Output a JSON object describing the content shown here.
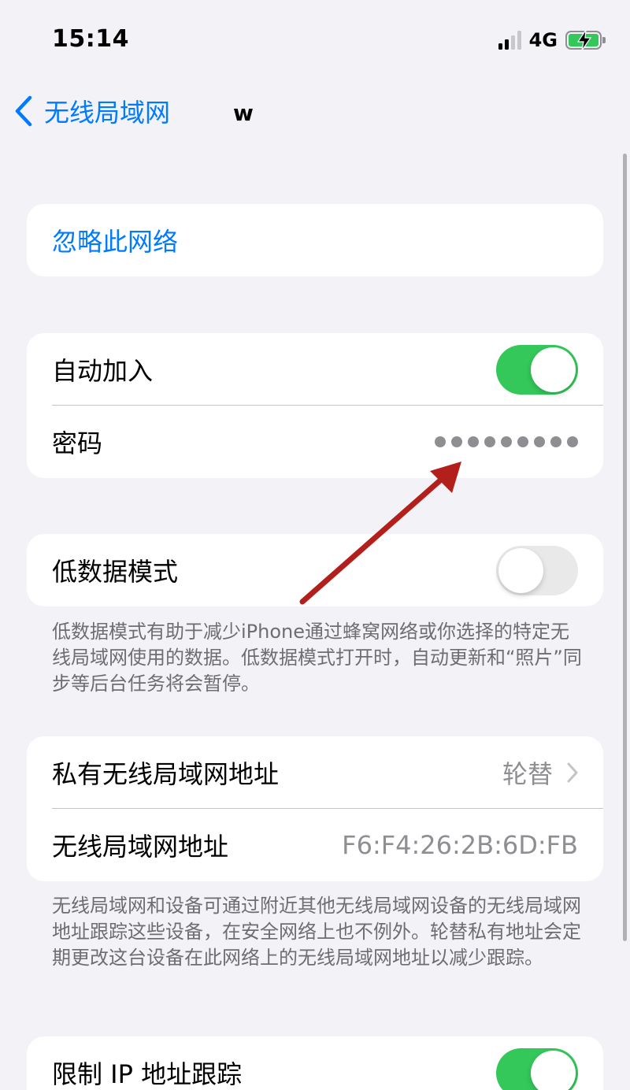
{
  "status_bar": {
    "time": "15:14",
    "network_type": "4G"
  },
  "nav": {
    "back_label": "无线局域网",
    "title": "wi"
  },
  "forget": {
    "label": "忽略此网络"
  },
  "auto_join": {
    "label": "自动加入",
    "enabled": true
  },
  "password": {
    "label": "密码",
    "masked": "••••••••••"
  },
  "low_data": {
    "label": "低数据模式",
    "enabled": false,
    "footnote": "低数据模式有助于减少iPhone通过蜂窝网络或你选择的特定无线局域网使用的数据。低数据模式打开时，自动更新和“照片”同步等后台任务将会暂停。"
  },
  "private_address": {
    "label": "私有无线局域网地址",
    "value": "轮替"
  },
  "wifi_address": {
    "label": "无线局域网地址",
    "value": "F6:F4:26:2B:6D:FB"
  },
  "address_footnote": {
    "text": "无线局域网和设备可通过附近其他无线局域网设备的无线局域网地址跟踪这些设备，在安全网络上也不例外。轮替私有地址会定期更改这台设备在此网络上的无线局域网地址以减少跟踪。"
  },
  "limit_ip": {
    "label": "限制 IP 地址跟踪",
    "enabled": true
  },
  "colors": {
    "accent": "#007aff",
    "toggle_on": "#34c759",
    "annotation": "#b3201c"
  }
}
